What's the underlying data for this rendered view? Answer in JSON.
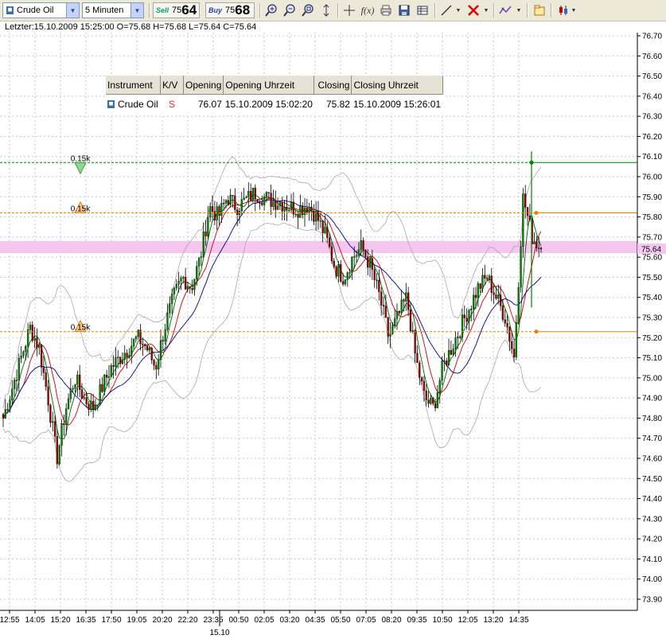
{
  "toolbar": {
    "instrument": "Crude Oil",
    "interval": "5 Minuten",
    "sell": {
      "label": "Sell",
      "small": "75",
      "big": "64"
    },
    "buy": {
      "label": "Buy",
      "small": "75",
      "big": "68"
    },
    "icons": [
      "zoom-in-icon",
      "zoom-out-icon",
      "zoom-fit-icon",
      "vertical-zoom-icon",
      "crosshair-icon",
      "function-icon",
      "print-icon",
      "save-icon",
      "table-icon",
      "line-tool-icon",
      "delete-icon",
      "indicator-icon",
      "properties-icon",
      "candlestick-icon"
    ],
    "fx_label": "f(x)"
  },
  "info_line": "Letzter:15.10.2009 15:25:00 O=75.68 H=75.68 L=75.64 C=75.64",
  "trade_table": {
    "headers": [
      "Instrument",
      "K/V",
      "Opening",
      "Opening Uhrzeit",
      "Closing",
      "Closing Uhrzeit"
    ],
    "row": [
      "Crude Oil",
      "S",
      "76.07",
      "15.10.2009 15:02:20",
      "75.82",
      "15.10.2009 15:26:01"
    ]
  },
  "order_markers": [
    "0.15k",
    "0.15k",
    "0.15k"
  ],
  "chart_data": {
    "type": "candlestick",
    "y_axis": {
      "min": 73.9,
      "max": 76.7,
      "step": 0.1,
      "ticks": [
        "76.70",
        "76.60",
        "76.50",
        "76.40",
        "76.30",
        "76.20",
        "76.10",
        "76.00",
        "75.90",
        "75.80",
        "75.70",
        "75.60",
        "75.50",
        "75.40",
        "75.30",
        "75.20",
        "75.10",
        "75.00",
        "74.90",
        "74.80",
        "74.70",
        "74.60",
        "74.50",
        "74.40",
        "74.30",
        "74.20",
        "74.10",
        "74.00",
        "73.90"
      ]
    },
    "x_ticks": [
      "12:55",
      "14:05",
      "15:20",
      "16:35",
      "17:50",
      "19:05",
      "20:20",
      "22:20",
      "23:35",
      "00:50",
      "02:05",
      "03:20",
      "04:35",
      "05:50",
      "07:05",
      "08:20",
      "09:35",
      "10:50",
      "12:05",
      "13:20",
      "14:35"
    ],
    "date_label": "15.10",
    "current_price": "75.64",
    "lines": {
      "green_dashed": 76.07,
      "orange_upper": 75.82,
      "orange_lower": 75.23
    },
    "close_path": [
      74.8,
      74.95,
      75.1,
      75.25,
      75.15,
      74.9,
      74.6,
      74.85,
      75.0,
      74.9,
      74.85,
      74.95,
      75.05,
      75.1,
      75.15,
      75.2,
      75.15,
      75.05,
      75.25,
      75.4,
      75.5,
      75.45,
      75.6,
      75.85,
      75.8,
      75.9,
      75.85,
      75.88,
      75.92,
      75.9,
      75.88,
      75.87,
      75.85,
      75.84,
      75.86,
      75.8,
      75.7,
      75.55,
      75.5,
      75.6,
      75.65,
      75.55,
      75.4,
      75.2,
      75.3,
      75.4,
      75.1,
      74.9,
      74.85,
      75.05,
      75.15,
      75.25,
      75.35,
      75.45,
      75.5,
      75.4,
      75.3,
      75.1,
      75.9,
      75.7,
      75.64
    ],
    "colors": {
      "bull": "#008800",
      "bear": "#990000",
      "ma1": "#cc0000",
      "ma2": "#000088",
      "ma3": "#006600",
      "bands": "#a8a8a8",
      "highlight": "#f4c6f0"
    }
  }
}
